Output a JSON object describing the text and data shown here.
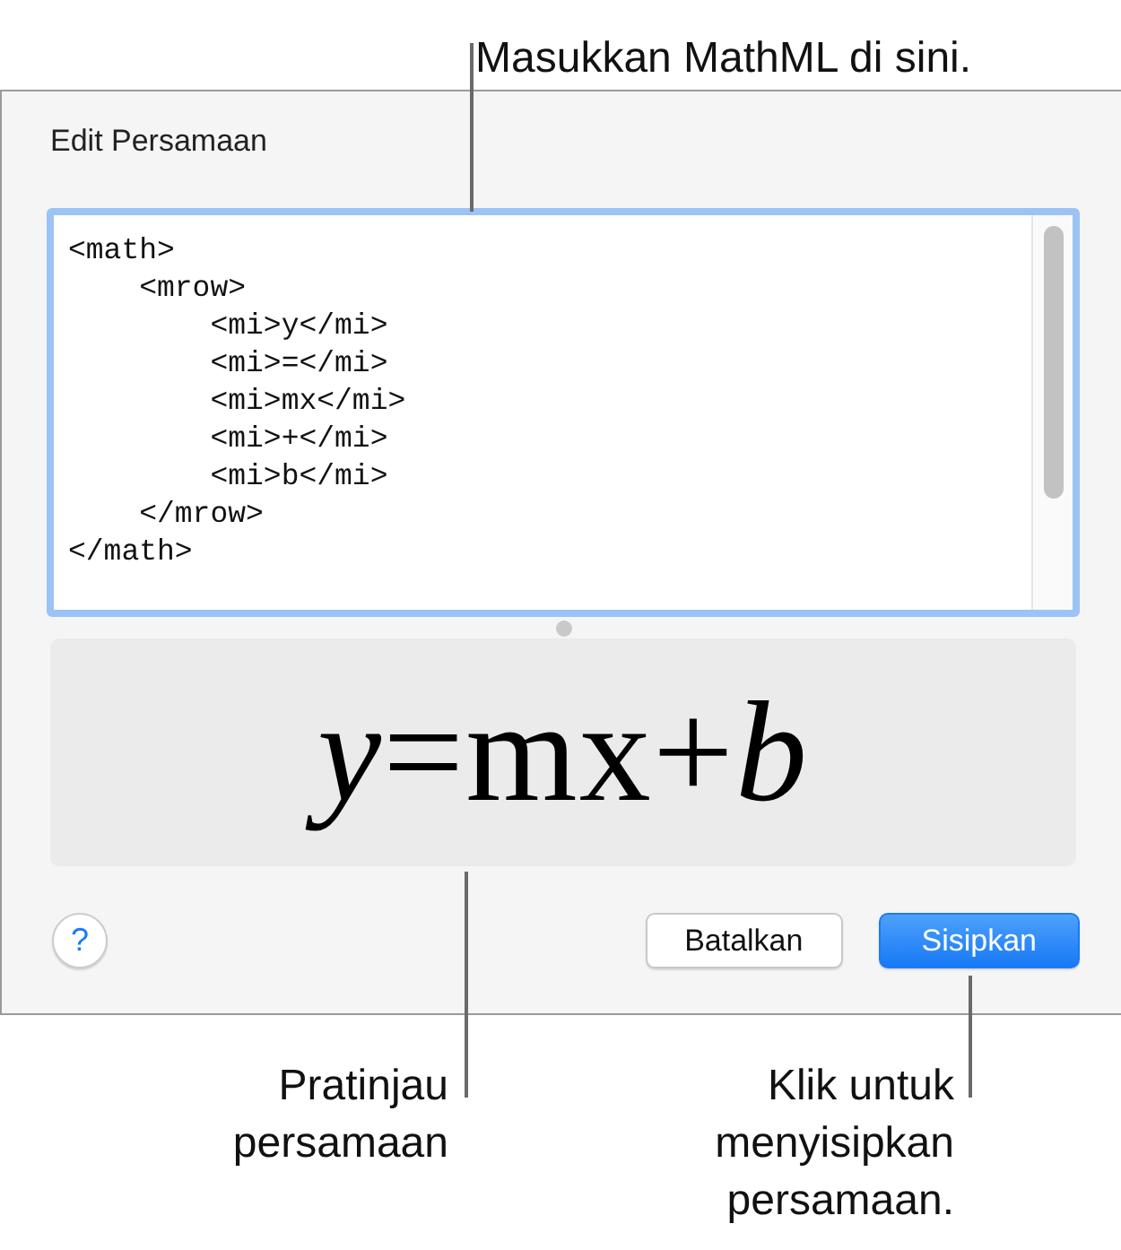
{
  "top_callout": "Masukkan MathML di sini.",
  "dialog": {
    "title": "Edit Persamaan",
    "mathml_field": {
      "value": "<math>\n    <mrow>\n        <mi>y</mi>\n        <mi>=</mi>\n        <mi>mx</mi>\n        <mi>+</mi>\n        <mi>b</mi>\n    </mrow>\n</math>",
      "focused": true
    },
    "preview": "*y*=mx+*b*",
    "help_button": "?",
    "buttons": [
      {
        "label": "Batalkan",
        "kind": "secondary"
      },
      {
        "label": "Sisipkan",
        "kind": "primary"
      }
    ]
  },
  "preview_callout": "Pratinjau persamaan",
  "insert_callout": "Klik untuk menyisipkan persamaan."
}
